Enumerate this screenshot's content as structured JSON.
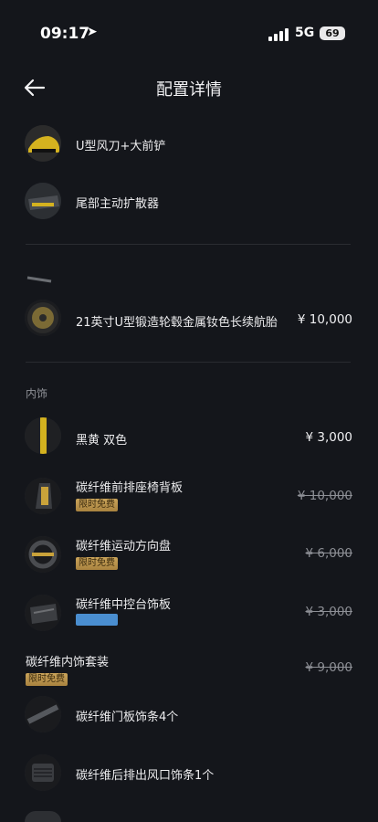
{
  "status": {
    "time": "09:17",
    "network": "5G",
    "battery": "69"
  },
  "nav": {
    "title": "配置详情"
  },
  "items_top": [
    {
      "label": "U型风刀+大前铲"
    },
    {
      "label": "尾部主动扩散器"
    }
  ],
  "wheel": {
    "label": "21英寸U型锻造轮毂金属钕色长续航胎",
    "price": "¥ 10,000"
  },
  "interior_section": "内饰",
  "interior": [
    {
      "label": "黑黄 双色",
      "price": "¥ 3,000"
    },
    {
      "label": "碳纤维前排座椅背板",
      "badge": "限时免费",
      "price": "¥ 10,000"
    },
    {
      "label": "碳纤维运动方向盘",
      "badge": "限时免费",
      "price": "¥ 6,000"
    },
    {
      "label": "碳纤维中控台饰板",
      "price": "¥ 3,000"
    }
  ],
  "package": {
    "label": "碳纤维内饰套装",
    "badge": "限时免费",
    "price": "¥ 9,000"
  },
  "package_items": [
    {
      "label": "碳纤维门板饰条4个"
    },
    {
      "label": "碳纤维后排出风口饰条1个"
    }
  ]
}
